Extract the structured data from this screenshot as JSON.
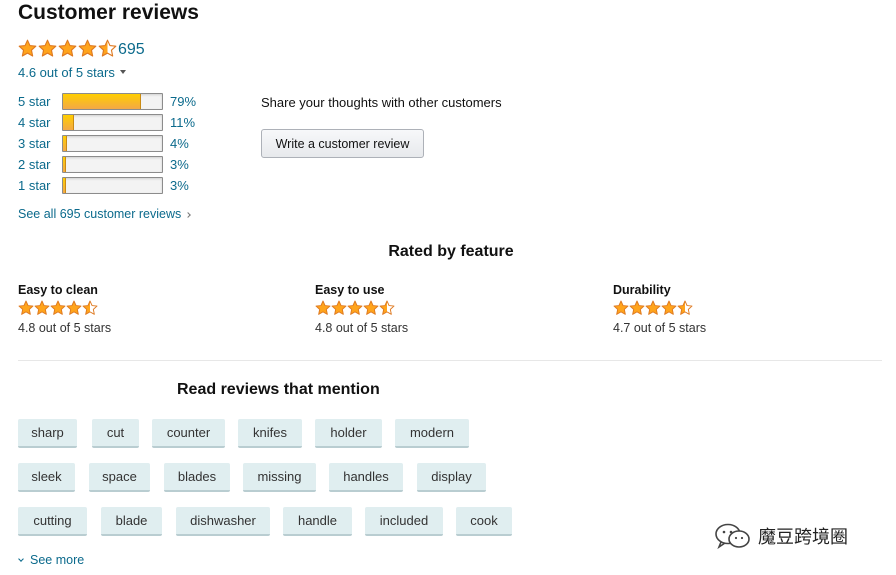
{
  "header": {
    "title": "Customer reviews"
  },
  "summary": {
    "rating_value": 4.6,
    "review_count": "695",
    "rating_text": "4.6 out of 5 stars",
    "see_all": "See all 695 customer reviews"
  },
  "histogram": [
    {
      "label": "5 star",
      "percent": 79,
      "percent_text": "79%"
    },
    {
      "label": "4 star",
      "percent": 11,
      "percent_text": "11%"
    },
    {
      "label": "3 star",
      "percent": 4,
      "percent_text": "4%"
    },
    {
      "label": "2 star",
      "percent": 3,
      "percent_text": "3%"
    },
    {
      "label": "1 star",
      "percent": 3,
      "percent_text": "3%"
    }
  ],
  "write_review": {
    "prompt": "Share your thoughts with other customers",
    "button_label": "Write a customer review"
  },
  "features": {
    "heading": "Rated by feature",
    "items": [
      {
        "name": "Easy to clean",
        "rating_value": 4.8,
        "rating_text": "4.8 out of 5 stars"
      },
      {
        "name": "Easy to use",
        "rating_value": 4.8,
        "rating_text": "4.8 out of 5 stars"
      },
      {
        "name": "Durability",
        "rating_value": 4.7,
        "rating_text": "4.7 out of 5 stars"
      }
    ]
  },
  "mentions": {
    "heading": "Read reviews that mention",
    "rows": [
      [
        "sharp",
        "cut",
        "counter",
        "knifes",
        "holder",
        "modern"
      ],
      [
        "sleek",
        "space",
        "blades",
        "missing",
        "handles",
        "display"
      ],
      [
        "cutting",
        "blade",
        "dishwasher",
        "handle",
        "included",
        "cook"
      ]
    ],
    "see_more": "See more"
  },
  "watermark": {
    "text": "魔豆跨境圈",
    "icon": "wechat-icon"
  },
  "colors": {
    "star": "#ffa41c",
    "star_outline": "#de7921",
    "link": "#0b6a8c",
    "chip_bg": "#e0eef0",
    "bar_fill": "#f3a847"
  }
}
